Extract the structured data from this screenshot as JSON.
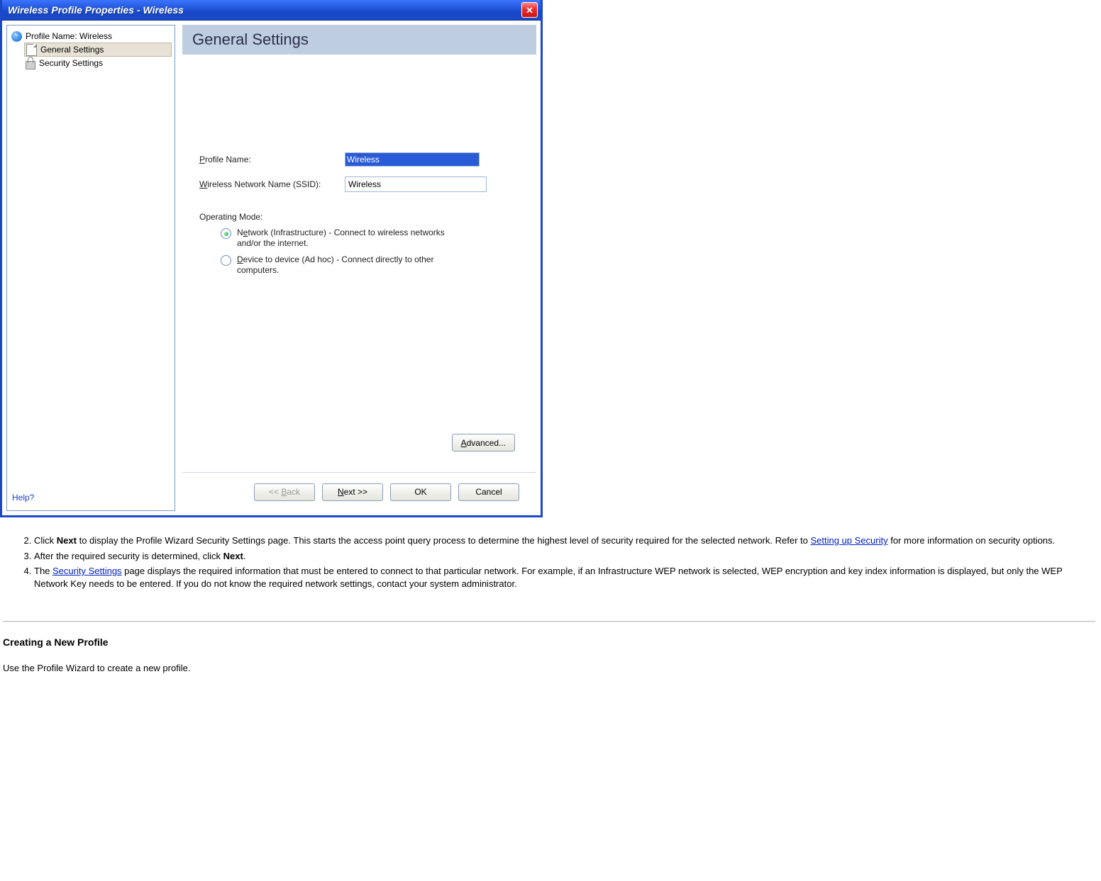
{
  "dialog": {
    "title": "Wireless Profile Properties - Wireless",
    "sidebar": {
      "root": "Profile Name: Wireless",
      "items": [
        {
          "label": "General Settings",
          "selected": true
        },
        {
          "label": "Security Settings",
          "selected": false
        }
      ]
    },
    "heading": "General Settings",
    "form": {
      "profile_name_label": "Profile Name:",
      "profile_name_value": "Wireless",
      "ssid_label": "Wireless Network Name (SSID):",
      "ssid_value": "Wireless",
      "op_mode_label": "Operating Mode:",
      "op_mode": {
        "infra": "Network (Infrastructure) - Connect to wireless networks and/or the internet.",
        "adhoc": "Device to device (Ad hoc) - Connect directly to other computers."
      },
      "advanced": "Advanced..."
    },
    "buttons": {
      "back": "<< Back",
      "next": "Next >>",
      "ok": "OK",
      "cancel": "Cancel"
    },
    "help": "Help?"
  },
  "article": {
    "step2_a": "Click ",
    "step2_bold": "Next",
    "step2_b": " to display the Profile Wizard Security Settings page. This starts the access point query process to determine the highest level of security required for the selected network. Refer to ",
    "step2_link": "Setting up Security",
    "step2_c": " for more information on security options.",
    "step3_a": "After the required security is determined, click ",
    "step3_bold": "Next",
    "step3_b": ".",
    "step4_a": "The ",
    "step4_link": "Security Settings",
    "step4_b": " page displays the required information that must be entered to connect to that particular network. For example, if an Infrastructure WEP network is selected, WEP encryption and key index information is displayed, but only the WEP Network Key needs to be entered. If you do not know the required network settings, contact your system administrator.",
    "heading": "Creating a New Profile",
    "para": "Use the Profile Wizard to create a new profile."
  }
}
